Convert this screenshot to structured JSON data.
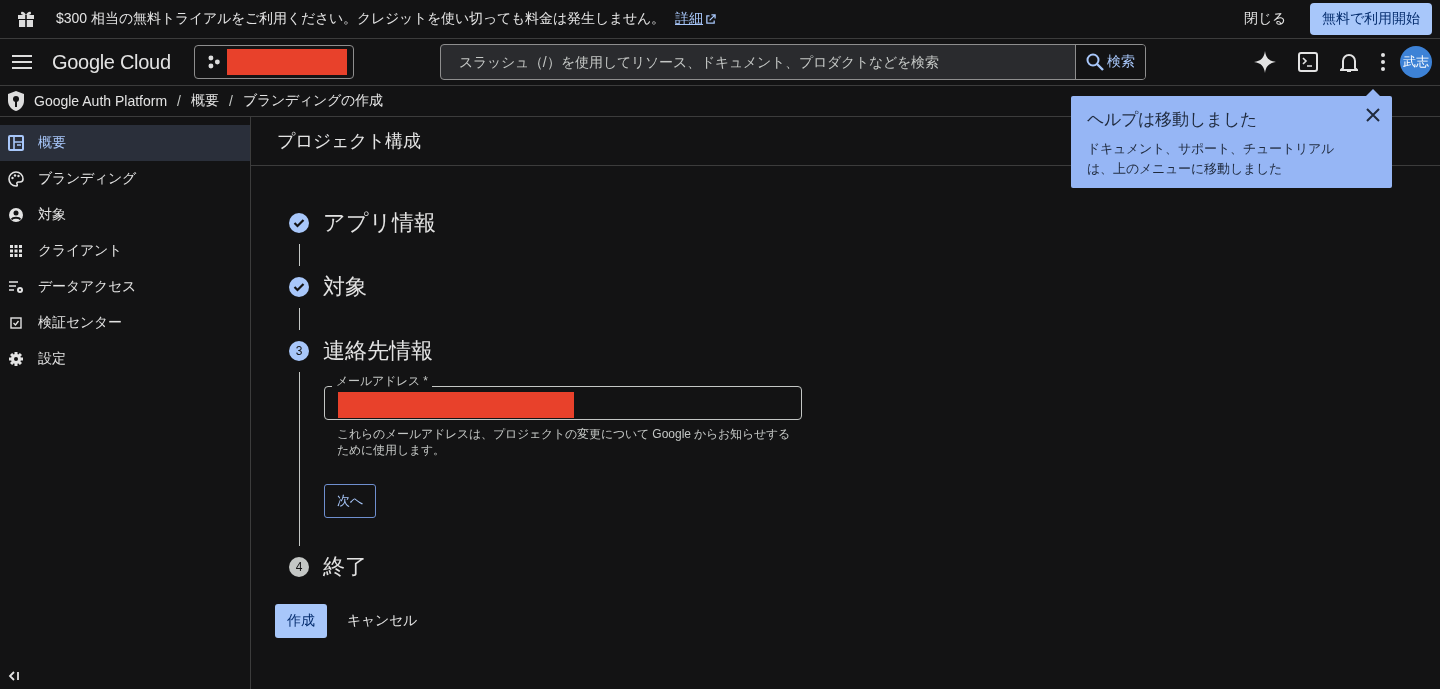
{
  "banner": {
    "message": "$300 相当の無料トライアルをご利用ください。クレジットを使い切っても料金は発生しません。",
    "link": "詳細",
    "close": "閉じる",
    "cta": "無料で利用開始"
  },
  "header": {
    "logo": "Google Cloud",
    "project_picker": {
      "redacted": true
    },
    "search": {
      "placeholder": "スラッシュ（/）を使用してリソース、ドキュメント、プロダクトなどを検索",
      "button": "検索"
    },
    "avatar": "武志"
  },
  "breadcrumb": [
    {
      "label": "Google Auth Platform"
    },
    {
      "separator": "/",
      "label": "概要"
    },
    {
      "separator": "/",
      "label": "ブランディングの作成"
    }
  ],
  "sidebar": {
    "items": [
      {
        "label": "概要",
        "selected": true
      },
      {
        "label": "ブランディング",
        "selected": false
      },
      {
        "label": "対象",
        "selected": false
      },
      {
        "label": "クライアント",
        "selected": false
      },
      {
        "label": "データアクセス",
        "selected": false
      },
      {
        "label": "検証センター",
        "selected": false
      },
      {
        "label": "設定",
        "selected": false
      }
    ]
  },
  "page_title": "プロジェクト構成",
  "steps": [
    {
      "title": "アプリ情報",
      "kind": "done"
    },
    {
      "title": "対象",
      "kind": "done"
    },
    {
      "title": "連絡先情報",
      "kind": "current",
      "number": "3",
      "field": {
        "label": "メールアドレス *",
        "redacted": true
      },
      "hint": "これらのメールアドレスは、プロジェクトの変更について Google からお知らせするために使用します。",
      "next": "次へ"
    },
    {
      "title": "終了",
      "kind": "pending",
      "number": "4"
    }
  ],
  "actions": {
    "create": "作成",
    "cancel": "キャンセル"
  },
  "help_popup": {
    "title": "ヘルプは移動しました",
    "body": "ドキュメント、サポート、チュートリアルは、上のメニューに移動しました"
  }
}
